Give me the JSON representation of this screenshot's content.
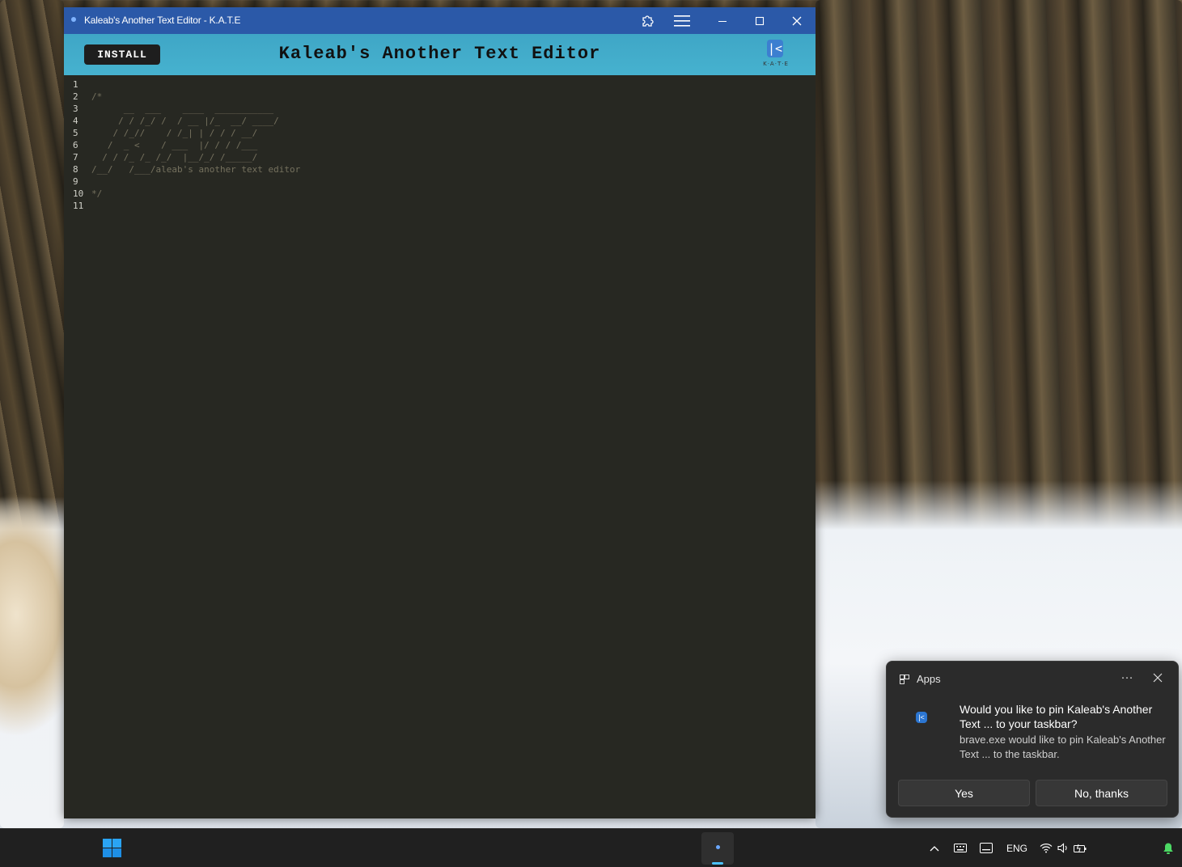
{
  "window": {
    "title": "Kaleab's Another Text Editor - K.A.T.E"
  },
  "header": {
    "install_label": "INSTALL",
    "app_title": "Kaleab's Another Text Editor",
    "logo_mark": "|<",
    "logo_text": "K·A·T·E"
  },
  "editor": {
    "lines": [
      {
        "n": "1",
        "text": ""
      },
      {
        "n": "2",
        "text": "/*"
      },
      {
        "n": "3",
        "text": "      __  ___    ____  ___________"
      },
      {
        "n": "4",
        "text": "     / / /_/ /  / __ |/_  __/ ____/"
      },
      {
        "n": "5",
        "text": "    / /_//    / /_| | / / / __/"
      },
      {
        "n": "6",
        "text": "   /  _ <    / ___  |/ / / /___"
      },
      {
        "n": "7",
        "text": "  / / /_ /_ /_/  |__/_/ /_____/"
      },
      {
        "n": "8",
        "text": "/__/   /___/aleab's another text editor"
      },
      {
        "n": "9",
        "text": ""
      },
      {
        "n": "10",
        "text": "*/"
      },
      {
        "n": "11",
        "text": ""
      }
    ]
  },
  "notification": {
    "app_name": "Apps",
    "more_label": "···",
    "title": "Would you like to pin Kaleab's Another Text ... to your taskbar?",
    "body": "brave.exe would like to pin Kaleab's Another Text ... to the taskbar.",
    "yes_label": "Yes",
    "no_label": "No, thanks"
  },
  "taskbar": {
    "language": "ENG"
  },
  "colors": {
    "titlebar": "#2b59a8",
    "header": "#46b2cf",
    "editor_bg": "#272822",
    "comment": "#75715e",
    "taskbar": "#202020",
    "accent": "#4cc2ff"
  }
}
